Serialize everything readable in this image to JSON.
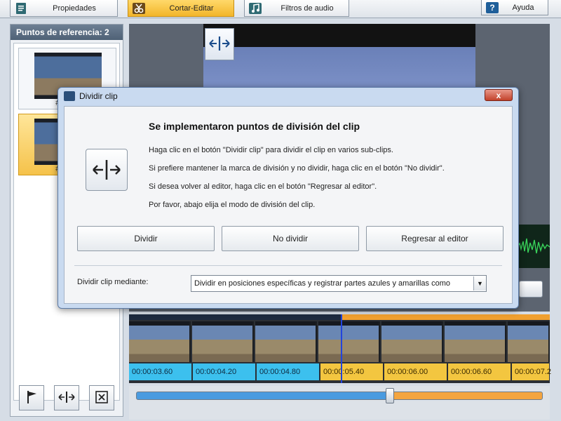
{
  "tabs": [
    {
      "label": "Propiedades",
      "icon": "properties-icon",
      "active": false
    },
    {
      "label": "Cortar-Editar",
      "icon": "scissors-icon",
      "active": true
    },
    {
      "label": "Filtros de audio",
      "icon": "music-note-icon",
      "active": false
    }
  ],
  "help": {
    "label": "Ayuda",
    "icon": "question-icon"
  },
  "left_panel": {
    "title": "Puntos de referencia: 2",
    "items": [
      {
        "label": "#01 : 0",
        "selected": false
      },
      {
        "label": "#02 : 0",
        "selected": true
      }
    ],
    "buttons": [
      {
        "icon": "flag-icon"
      },
      {
        "icon": "split-marker-icon"
      },
      {
        "icon": "delete-marker-icon"
      }
    ]
  },
  "timeline": {
    "timecodes": [
      {
        "label": "00:00:03.60",
        "state": "blue"
      },
      {
        "label": "00:00:04.20",
        "state": "blue"
      },
      {
        "label": "00:00:04.80",
        "state": "blue"
      },
      {
        "label": "00:00:05.40",
        "state": "yellow"
      },
      {
        "label": "00:00:06.00",
        "state": "yellow"
      },
      {
        "label": "00:00:06.60",
        "state": "yellow"
      },
      {
        "label": "00:00:07.2",
        "state": "yellow"
      }
    ]
  },
  "dialog": {
    "title": "Dividir clip",
    "close": "x",
    "heading": "Se implementaron puntos de división del clip",
    "lines": [
      "Haga clic en el botón \"Dividir clip\" para dividir el clip en varios sub-clips.",
      "Si prefiere mantener la marca de división y no dividir, haga clic en el botón \"No dividir\".",
      "Si desea volver al editor, haga clic en el botón \"Regresar al editor\".",
      "Por favor, abajo elija el modo de división del clip."
    ],
    "buttons": {
      "split": "Dividir",
      "no_split": "No dividir",
      "back": "Regresar al editor"
    },
    "mode_label": "Dividir clip mediante:",
    "mode_value": "Dividir en posiciones específicas y registrar partes azules y amarillas como"
  },
  "colors": {
    "accent_tab": "#f2b52a",
    "timecode_blue": "#3cc0ee",
    "timecode_yellow": "#f3c640",
    "dialog_frame": "#c9daf0"
  }
}
